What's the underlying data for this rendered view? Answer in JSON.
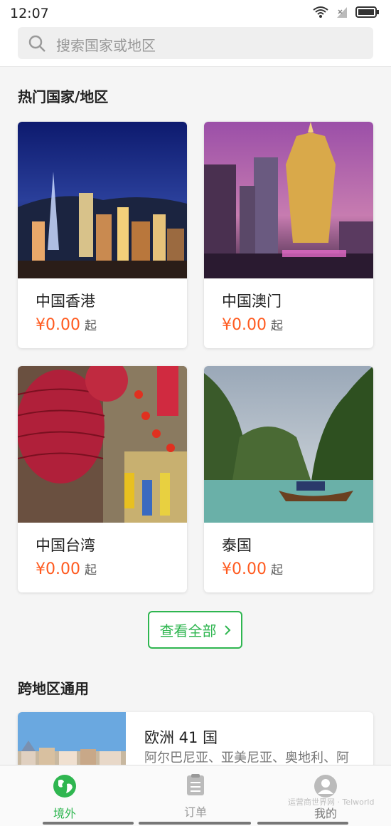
{
  "status_bar": {
    "time": "12:07"
  },
  "search": {
    "placeholder": "搜索国家或地区"
  },
  "hot_section": {
    "title": "热门国家/地区"
  },
  "destinations": [
    {
      "name": "中国香港",
      "price": "¥0.00",
      "suffix": "起"
    },
    {
      "name": "中国澳门",
      "price": "¥0.00",
      "suffix": "起"
    },
    {
      "name": "中国台湾",
      "price": "¥0.00",
      "suffix": "起"
    },
    {
      "name": "泰国",
      "price": "¥0.00",
      "suffix": "起"
    }
  ],
  "view_all": {
    "label": "查看全部"
  },
  "cross_section": {
    "title": "跨地区通用"
  },
  "region_card": {
    "title": "欧洲 41 国",
    "desc": "阿尔巴尼亚、亚美尼亚、奥地利、阿"
  },
  "tabbar": {
    "tabs": [
      {
        "label": "境外",
        "active": true
      },
      {
        "label": "订单",
        "active": false
      },
      {
        "label": "我的",
        "active": false
      }
    ]
  },
  "watermark": "运营商世界网 · Telworld",
  "colors": {
    "accent": "#2fb650",
    "price": "#ff5a1f"
  }
}
